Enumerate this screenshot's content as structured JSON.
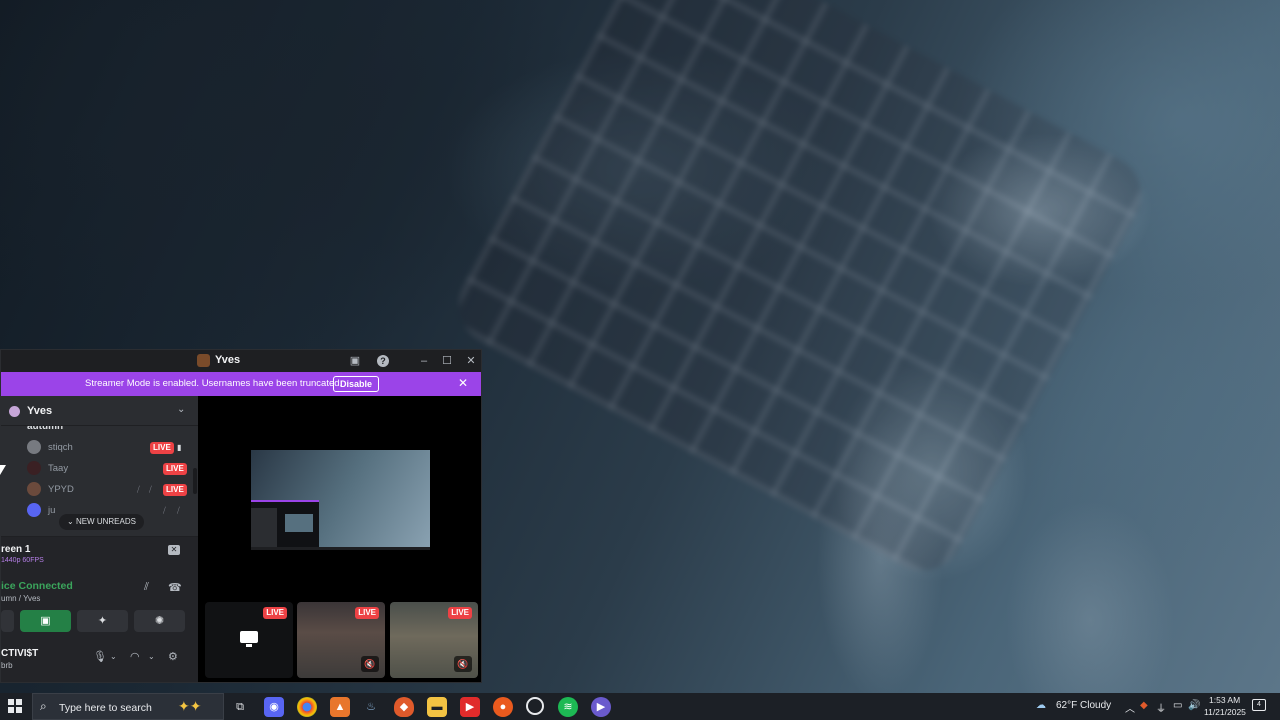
{
  "window": {
    "title": "Yves",
    "banner_message": "Streamer Mode is enabled. Usernames have been truncated.",
    "banner_button": "Disable"
  },
  "sidebar": {
    "server_name": "Yves",
    "partial_member": "autumn",
    "members": [
      {
        "name": "stiqch",
        "live": "LIVE",
        "color": "#777a80"
      },
      {
        "name": "Taay",
        "live": "LIVE",
        "color": "#3a2023"
      },
      {
        "name": "YPYD",
        "live": "LIVE",
        "color": "#6b4a3c"
      },
      {
        "name": "ju",
        "live": "",
        "color": "#5865f2"
      }
    ],
    "new_unreads": "NEW UNREADS"
  },
  "stream_panel": {
    "title": "reen 1",
    "quality": "1440p 60FPS",
    "voice_status": "ice Connected",
    "voice_channel": "umn / Yves"
  },
  "user": {
    "name": "CTIVI$T",
    "status": "brb"
  },
  "stage": {
    "tiles": [
      {
        "type": "screen",
        "live": "LIVE"
      },
      {
        "type": "game",
        "live": "LIVE"
      },
      {
        "type": "game",
        "live": "LIVE"
      }
    ]
  },
  "taskbar": {
    "search_placeholder": "Type here to search",
    "weather": "62°F  Cloudy",
    "time": "1:53 AM",
    "date": "11/21/2025",
    "notification_count": "4"
  },
  "colors": {
    "streamer_banner": "#9b44e8",
    "live_red": "#ed4245",
    "connected_green": "#3ba55c"
  }
}
